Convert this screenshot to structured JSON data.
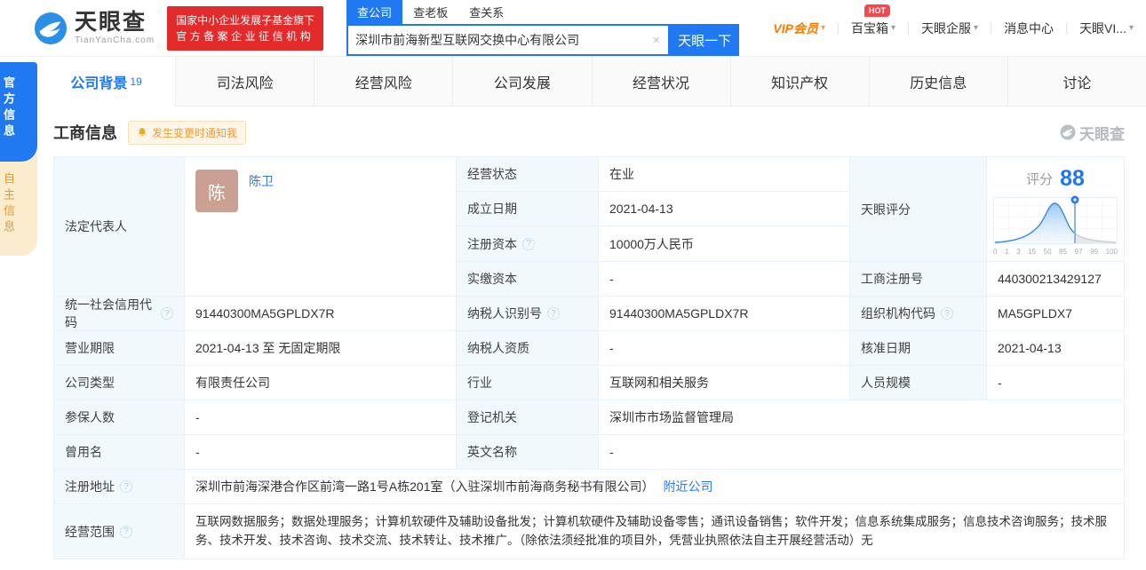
{
  "icons": {
    "help": "?",
    "clear": "×",
    "caret": "▾"
  },
  "colors": {
    "brand_blue": "#2179f2",
    "vip_orange": "#ff7a00",
    "badge_red": "#e32b2b",
    "notify_orange": "#f09b37",
    "score_blue": "#2177f0"
  },
  "header": {
    "logo": {
      "title": "天眼查",
      "subtitle": "TianYanCha.com"
    },
    "badge": {
      "line1": "国家中小企业发展子基金旗下",
      "line2": "官方备案企业征信机构"
    },
    "search": {
      "tabs": [
        {
          "label": "查公司",
          "active": true
        },
        {
          "label": "查老板",
          "active": false
        },
        {
          "label": "查关系",
          "active": false
        }
      ],
      "value": "深圳市前海新型互联网交换中心有限公司",
      "button": "天眼一下"
    },
    "nav": [
      {
        "label": "VIP会员"
      },
      {
        "label": "百宝箱",
        "badge": "HOT"
      },
      {
        "label": "天眼企服"
      },
      {
        "label": "消息中心"
      },
      {
        "label": "天眼VI..."
      }
    ]
  },
  "sidebar": {
    "tabs": [
      {
        "label": "官方信息",
        "active": true
      },
      {
        "label": "自主信息",
        "active": false
      }
    ]
  },
  "nav_tabs": [
    {
      "label": "公司背景",
      "count": "19",
      "active": true
    },
    {
      "label": "司法风险"
    },
    {
      "label": "经营风险"
    },
    {
      "label": "公司发展"
    },
    {
      "label": "经营状况"
    },
    {
      "label": "知识产权"
    },
    {
      "label": "历史信息"
    },
    {
      "label": "讨论"
    }
  ],
  "section": {
    "title": "工商信息",
    "notify_label": "发生变更时通知我",
    "watermark": "天眼查"
  },
  "table": {
    "legal_rep": {
      "label": "法定代表人",
      "avatar": "陈",
      "name": "陈卫"
    },
    "status": {
      "label": "经营状态",
      "value": "在业"
    },
    "establish": {
      "label": "成立日期",
      "value": "2021-04-13"
    },
    "reg_capital": {
      "label": "注册资本",
      "value": "10000万人民币"
    },
    "paid_capital": {
      "label": "实缴资本",
      "value": "-"
    },
    "score": {
      "label": "天眼评分",
      "score_word": "评分",
      "score": "88",
      "ticks": [
        "0",
        "1",
        "3",
        "15",
        "50",
        "85",
        "97",
        "99",
        "100"
      ]
    },
    "reg_no": {
      "label": "工商注册号",
      "value": "440300213429127"
    },
    "credit_code": {
      "label": "统一社会信用代码",
      "value": "91440300MA5GPLDX7R"
    },
    "taxpayer_id": {
      "label": "纳税人识别号",
      "value": "91440300MA5GPLDX7R"
    },
    "org_code": {
      "label": "组织机构代码",
      "value": "MA5GPLDX7"
    },
    "business_term": {
      "label": "营业期限",
      "value": "2021-04-13 至 无固定期限"
    },
    "taxpayer_quality": {
      "label": "纳税人资质",
      "value": "-"
    },
    "approval_date": {
      "label": "核准日期",
      "value": "2021-04-13"
    },
    "company_type": {
      "label": "公司类型",
      "value": "有限责任公司"
    },
    "industry": {
      "label": "行业",
      "value": "互联网和相关服务"
    },
    "staff_size": {
      "label": "人员规模",
      "value": "-"
    },
    "insured_count": {
      "label": "参保人数",
      "value": "-"
    },
    "registry": {
      "label": "登记机关",
      "value": "深圳市市场监督管理局"
    },
    "former_name": {
      "label": "曾用名",
      "value": "-"
    },
    "english_name": {
      "label": "英文名称",
      "value": "-"
    },
    "address": {
      "label": "注册地址",
      "value": "深圳市前海深港合作区前湾一路1号A栋201室（入驻深圳市前海商务秘书有限公司）",
      "link": "附近公司"
    },
    "scope": {
      "label": "经营范围",
      "value": "互联网数据服务；数据处理服务；计算机软硬件及辅助设备批发；计算机软硬件及辅助设备零售；通讯设备销售；软件开发；信息系统集成服务；信息技术咨询服务；技术服务、技术开发、技术咨询、技术交流、技术转让、技术推广。（除依法须经批准的项目外，凭营业执照依法自主开展经营活动）无"
    }
  },
  "chart_data": {
    "type": "area",
    "title": "天眼评分",
    "score": 88,
    "x_ticks": [
      "0",
      "1",
      "3",
      "15",
      "50",
      "85",
      "97",
      "99",
      "100"
    ],
    "marker_value": 88,
    "note": "bell-shaped score distribution, blue filled left of marker, gray right"
  }
}
